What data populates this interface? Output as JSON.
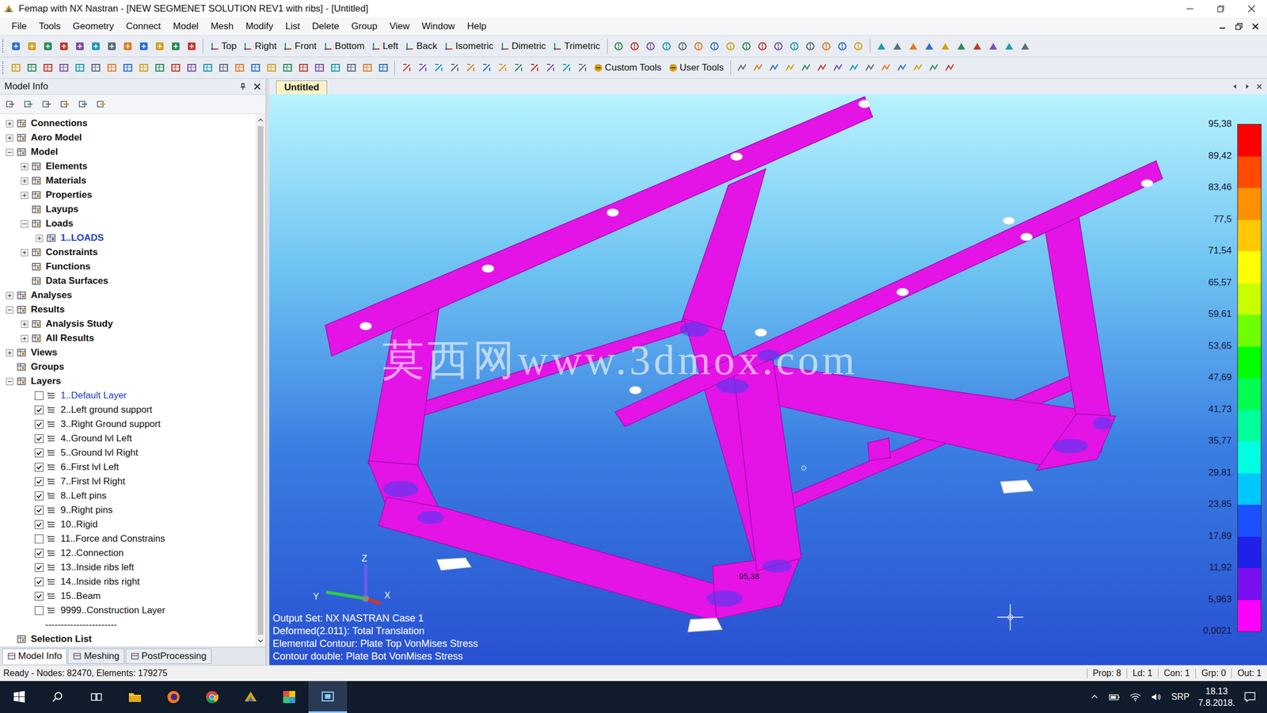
{
  "window": {
    "title": "Femap with NX Nastran - [NEW SEGMENET SOLUTION REV1 with ribs] - [Untitled]"
  },
  "menu": [
    "File",
    "Tools",
    "Geometry",
    "Connect",
    "Model",
    "Mesh",
    "Modify",
    "List",
    "Delete",
    "Group",
    "View",
    "Window",
    "Help"
  ],
  "toolbar_views": [
    "Top",
    "Right",
    "Front",
    "Bottom",
    "Left",
    "Back",
    "Isometric",
    "Dimetric",
    "Trimetric"
  ],
  "toolbar_tools": [
    "Custom Tools",
    "User Tools"
  ],
  "model_info": {
    "title": "Model Info",
    "tree": [
      {
        "label": "Connections",
        "level": 0,
        "kind": "node",
        "expandable": true,
        "expanded": false,
        "active": false,
        "checked": false
      },
      {
        "label": "Aero Model",
        "level": 0,
        "kind": "node",
        "expandable": true,
        "expanded": false,
        "active": false,
        "checked": false
      },
      {
        "label": "Model",
        "level": 0,
        "kind": "node",
        "expandable": true,
        "expanded": true,
        "active": false,
        "checked": false
      },
      {
        "label": "Elements",
        "level": 1,
        "kind": "node",
        "expandable": true,
        "expanded": false,
        "active": false,
        "checked": false
      },
      {
        "label": "Materials",
        "level": 1,
        "kind": "node",
        "expandable": true,
        "expanded": false,
        "active": false,
        "checked": false
      },
      {
        "label": "Properties",
        "level": 1,
        "kind": "node",
        "expandable": true,
        "expanded": false,
        "active": false,
        "checked": false
      },
      {
        "label": "Layups",
        "level": 1,
        "kind": "node",
        "expandable": false,
        "expanded": false,
        "active": false,
        "checked": false
      },
      {
        "label": "Loads",
        "level": 1,
        "kind": "node",
        "expandable": true,
        "expanded": true,
        "active": false,
        "checked": false
      },
      {
        "label": "1..LOADS",
        "level": 2,
        "kind": "node",
        "expandable": true,
        "expanded": false,
        "active": true,
        "checked": false
      },
      {
        "label": "Constraints",
        "level": 1,
        "kind": "node",
        "expandable": true,
        "expanded": false,
        "active": false,
        "checked": false
      },
      {
        "label": "Functions",
        "level": 1,
        "kind": "node",
        "expandable": false,
        "expanded": false,
        "active": false,
        "checked": false
      },
      {
        "label": "Data Surfaces",
        "level": 1,
        "kind": "node",
        "expandable": false,
        "expanded": false,
        "active": false,
        "checked": false
      },
      {
        "label": "Analyses",
        "level": 0,
        "kind": "node",
        "expandable": true,
        "expanded": false,
        "active": false,
        "checked": false
      },
      {
        "label": "Results",
        "level": 0,
        "kind": "node",
        "expandable": true,
        "expanded": true,
        "active": false,
        "checked": false
      },
      {
        "label": "Analysis Study",
        "level": 1,
        "kind": "node",
        "expandable": true,
        "expanded": false,
        "active": false,
        "checked": false
      },
      {
        "label": "All Results",
        "level": 1,
        "kind": "node",
        "expandable": true,
        "expanded": false,
        "active": false,
        "checked": false
      },
      {
        "label": "Views",
        "level": 0,
        "kind": "node",
        "expandable": true,
        "expanded": false,
        "active": false,
        "checked": false
      },
      {
        "label": "Groups",
        "level": 0,
        "kind": "node",
        "expandable": false,
        "expanded": false,
        "active": false,
        "checked": false
      },
      {
        "label": "Layers",
        "level": 0,
        "kind": "node",
        "expandable": true,
        "expanded": true,
        "active": false,
        "checked": false
      },
      {
        "label": "1..Default Layer",
        "level": 2,
        "kind": "layer",
        "expandable": false,
        "expanded": false,
        "active": true,
        "checked": false
      },
      {
        "label": "2..Left ground support",
        "level": 2,
        "kind": "layer",
        "expandable": false,
        "expanded": false,
        "active": false,
        "checked": true
      },
      {
        "label": "3..Right Ground support",
        "level": 2,
        "kind": "layer",
        "expandable": false,
        "expanded": false,
        "active": false,
        "checked": true
      },
      {
        "label": "4..Ground lvl Left",
        "level": 2,
        "kind": "layer",
        "expandable": false,
        "expanded": false,
        "active": false,
        "checked": true
      },
      {
        "label": "5..Ground lvl Right",
        "level": 2,
        "kind": "layer",
        "expandable": false,
        "expanded": false,
        "active": false,
        "checked": true
      },
      {
        "label": "6..First lvl Left",
        "level": 2,
        "kind": "layer",
        "expandable": false,
        "expanded": false,
        "active": false,
        "checked": true
      },
      {
        "label": "7..First lvl Right",
        "level": 2,
        "kind": "layer",
        "expandable": false,
        "expanded": false,
        "active": false,
        "checked": true
      },
      {
        "label": "8..Left pins",
        "level": 2,
        "kind": "layer",
        "expandable": false,
        "expanded": false,
        "active": false,
        "checked": true
      },
      {
        "label": "9..Right pins",
        "level": 2,
        "kind": "layer",
        "expandable": false,
        "expanded": false,
        "active": false,
        "checked": true
      },
      {
        "label": "10..Rigid",
        "level": 2,
        "kind": "layer",
        "expandable": false,
        "expanded": false,
        "active": false,
        "checked": true
      },
      {
        "label": "11..Force and Constrains",
        "level": 2,
        "kind": "layer",
        "expandable": false,
        "expanded": false,
        "active": false,
        "checked": false
      },
      {
        "label": "12..Connection",
        "level": 2,
        "kind": "layer",
        "expandable": false,
        "expanded": false,
        "active": false,
        "checked": true
      },
      {
        "label": "13..Inside ribs left",
        "level": 2,
        "kind": "layer",
        "expandable": false,
        "expanded": false,
        "active": false,
        "checked": true
      },
      {
        "label": "14..Inside ribs right",
        "level": 2,
        "kind": "layer",
        "expandable": false,
        "expanded": false,
        "active": false,
        "checked": true
      },
      {
        "label": "15..Beam",
        "level": 2,
        "kind": "layer",
        "expandable": false,
        "expanded": false,
        "active": false,
        "checked": true
      },
      {
        "label": "9999..Construction Layer",
        "level": 2,
        "kind": "layer",
        "expandable": false,
        "expanded": false,
        "active": false,
        "checked": false
      },
      {
        "label": "-----------------------",
        "level": 2,
        "kind": "separator",
        "expandable": false,
        "expanded": false,
        "active": false,
        "checked": false
      },
      {
        "label": "Selection List",
        "level": 0,
        "kind": "node",
        "expandable": false,
        "expanded": false,
        "active": false,
        "checked": false
      }
    ],
    "tabs": [
      {
        "label": "Model Info",
        "selected": true
      },
      {
        "label": "Meshing",
        "selected": false
      },
      {
        "label": "PostProcessing",
        "selected": false
      }
    ]
  },
  "viewport": {
    "tab": {
      "label": "Untitled",
      "selected": true
    },
    "watermark": "莫西网www.3dmox.com",
    "legend": {
      "ticks": [
        "95,38",
        "89,42",
        "83,46",
        "77,5",
        "71,54",
        "65,57",
        "59,61",
        "53,65",
        "47,69",
        "41,73",
        "35,77",
        "29,81",
        "23,85",
        "17,89",
        "11,92",
        "5,963",
        "0,0021"
      ],
      "bands": [
        {
          "color": "#ff0000"
        },
        {
          "color": "#ff4a00"
        },
        {
          "color": "#ff9000"
        },
        {
          "color": "#ffc800"
        },
        {
          "color": "#ffff00"
        },
        {
          "color": "#c8ff00"
        },
        {
          "color": "#70ff00"
        },
        {
          "color": "#00ff00"
        },
        {
          "color": "#00ff50"
        },
        {
          "color": "#00ff9a"
        },
        {
          "color": "#00ffe0"
        },
        {
          "color": "#00c8ff"
        },
        {
          "color": "#1a50ff"
        },
        {
          "color": "#2020e8"
        },
        {
          "color": "#7a10f0"
        },
        {
          "color": "#ff00ff"
        }
      ]
    },
    "info_lines": [
      "Output Set: NX NASTRAN Case 1",
      "Deformed(2.011): Total Translation",
      "Elemental Contour: Plate Top VonMises Stress",
      "Contour double: Plate Bot VonMises Stress"
    ],
    "axes": {
      "z": "Z",
      "y": "Y",
      "x": "X"
    },
    "node_label": "95,38"
  },
  "status_bar": {
    "message": "Ready - Nodes: 82470, Elements: 179275",
    "fields": [
      "Prop: 8",
      "Ld: 1",
      "Con: 1",
      "Grp: 0",
      "Out: 1"
    ]
  },
  "taskbar": {
    "language": "SRP",
    "time": "18.13",
    "date": "7.8.2018."
  }
}
